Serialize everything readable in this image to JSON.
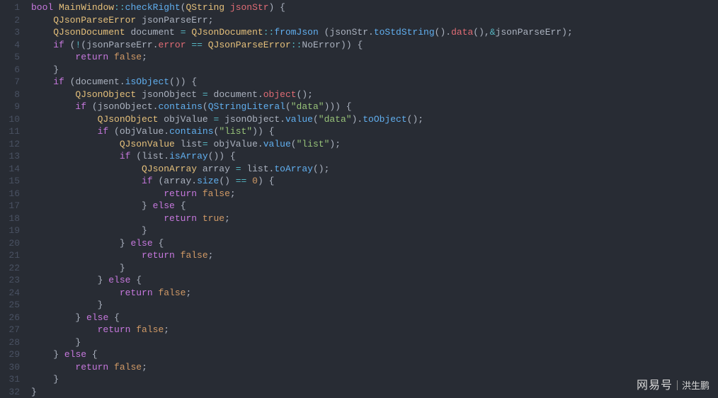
{
  "lines": [
    {
      "n": 1,
      "tokens": [
        [
          "kw",
          "bool"
        ],
        [
          "sp",
          " "
        ],
        [
          "class",
          "MainWindow"
        ],
        [
          "op",
          "::"
        ],
        [
          "fn",
          "checkRight"
        ],
        [
          "punc",
          "("
        ],
        [
          "class",
          "QString"
        ],
        [
          "sp",
          " "
        ],
        [
          "param",
          "jsonStr"
        ],
        [
          "punc",
          ")"
        ],
        [
          "sp",
          " "
        ],
        [
          "punc",
          "{"
        ]
      ]
    },
    {
      "n": 2,
      "tokens": [
        [
          "sp",
          "    "
        ],
        [
          "class",
          "QJsonParseError"
        ],
        [
          "sp",
          " "
        ],
        [
          "ident",
          "jsonParseErr"
        ],
        [
          "punc",
          ";"
        ]
      ]
    },
    {
      "n": 3,
      "tokens": [
        [
          "sp",
          "    "
        ],
        [
          "class",
          "QJsonDocument"
        ],
        [
          "sp",
          " "
        ],
        [
          "ident",
          "document"
        ],
        [
          "sp",
          " "
        ],
        [
          "op",
          "="
        ],
        [
          "sp",
          " "
        ],
        [
          "class",
          "QJsonDocument"
        ],
        [
          "op",
          "::"
        ],
        [
          "fn",
          "fromJson"
        ],
        [
          "sp",
          " "
        ],
        [
          "punc",
          "("
        ],
        [
          "ident",
          "jsonStr"
        ],
        [
          "punc",
          "."
        ],
        [
          "call",
          "toStdString"
        ],
        [
          "punc",
          "()"
        ],
        [
          "punc",
          "."
        ],
        [
          "err",
          "data"
        ],
        [
          "punc",
          "()"
        ],
        [
          "punc",
          ","
        ],
        [
          "op",
          "&"
        ],
        [
          "ident",
          "jsonParseErr"
        ],
        [
          "punc",
          ")"
        ],
        [
          "punc",
          ";"
        ]
      ]
    },
    {
      "n": 4,
      "tokens": [
        [
          "sp",
          "    "
        ],
        [
          "kw",
          "if"
        ],
        [
          "sp",
          " "
        ],
        [
          "punc",
          "("
        ],
        [
          "op",
          "!"
        ],
        [
          "punc",
          "("
        ],
        [
          "ident",
          "jsonParseErr"
        ],
        [
          "punc",
          "."
        ],
        [
          "prop",
          "error"
        ],
        [
          "sp",
          " "
        ],
        [
          "op",
          "=="
        ],
        [
          "sp",
          " "
        ],
        [
          "class",
          "QJsonParseError"
        ],
        [
          "op",
          "::"
        ],
        [
          "ident",
          "NoError"
        ],
        [
          "punc",
          "))"
        ],
        [
          "sp",
          " "
        ],
        [
          "punc",
          "{"
        ]
      ]
    },
    {
      "n": 5,
      "tokens": [
        [
          "sp",
          "        "
        ],
        [
          "kw",
          "return"
        ],
        [
          "sp",
          " "
        ],
        [
          "const",
          "false"
        ],
        [
          "punc",
          ";"
        ]
      ]
    },
    {
      "n": 6,
      "tokens": [
        [
          "sp",
          "    "
        ],
        [
          "punc",
          "}"
        ]
      ]
    },
    {
      "n": 7,
      "tokens": [
        [
          "sp",
          "    "
        ],
        [
          "kw",
          "if"
        ],
        [
          "sp",
          " "
        ],
        [
          "punc",
          "("
        ],
        [
          "ident",
          "document"
        ],
        [
          "punc",
          "."
        ],
        [
          "call",
          "isObject"
        ],
        [
          "punc",
          "())"
        ],
        [
          "sp",
          " "
        ],
        [
          "punc",
          "{"
        ]
      ]
    },
    {
      "n": 8,
      "tokens": [
        [
          "sp",
          "        "
        ],
        [
          "class",
          "QJsonObject"
        ],
        [
          "sp",
          " "
        ],
        [
          "ident",
          "jsonObject"
        ],
        [
          "sp",
          " "
        ],
        [
          "op",
          "="
        ],
        [
          "sp",
          " "
        ],
        [
          "ident",
          "document"
        ],
        [
          "punc",
          "."
        ],
        [
          "err",
          "object"
        ],
        [
          "punc",
          "()"
        ],
        [
          "punc",
          ";"
        ]
      ]
    },
    {
      "n": 9,
      "tokens": [
        [
          "sp",
          "        "
        ],
        [
          "kw",
          "if"
        ],
        [
          "sp",
          " "
        ],
        [
          "punc",
          "("
        ],
        [
          "ident",
          "jsonObject"
        ],
        [
          "punc",
          "."
        ],
        [
          "call",
          "contains"
        ],
        [
          "punc",
          "("
        ],
        [
          "call",
          "QStringLiteral"
        ],
        [
          "punc",
          "("
        ],
        [
          "str",
          "\"data\""
        ],
        [
          "punc",
          ")))"
        ],
        [
          "sp",
          " "
        ],
        [
          "punc",
          "{"
        ]
      ]
    },
    {
      "n": 10,
      "tokens": [
        [
          "sp",
          "            "
        ],
        [
          "class",
          "QJsonObject"
        ],
        [
          "sp",
          " "
        ],
        [
          "ident",
          "objValue"
        ],
        [
          "sp",
          " "
        ],
        [
          "op",
          "="
        ],
        [
          "sp",
          " "
        ],
        [
          "ident",
          "jsonObject"
        ],
        [
          "punc",
          "."
        ],
        [
          "call",
          "value"
        ],
        [
          "punc",
          "("
        ],
        [
          "str",
          "\"data\""
        ],
        [
          "punc",
          ")"
        ],
        [
          "punc",
          "."
        ],
        [
          "call",
          "toObject"
        ],
        [
          "punc",
          "()"
        ],
        [
          "punc",
          ";"
        ]
      ]
    },
    {
      "n": 11,
      "tokens": [
        [
          "sp",
          "            "
        ],
        [
          "kw",
          "if"
        ],
        [
          "sp",
          " "
        ],
        [
          "punc",
          "("
        ],
        [
          "ident",
          "objValue"
        ],
        [
          "punc",
          "."
        ],
        [
          "call",
          "contains"
        ],
        [
          "punc",
          "("
        ],
        [
          "str",
          "\"list\""
        ],
        [
          "punc",
          "))"
        ],
        [
          "sp",
          " "
        ],
        [
          "punc",
          "{"
        ]
      ]
    },
    {
      "n": 12,
      "tokens": [
        [
          "sp",
          "                "
        ],
        [
          "class",
          "QJsonValue"
        ],
        [
          "sp",
          " "
        ],
        [
          "ident",
          "list"
        ],
        [
          "op",
          "="
        ],
        [
          "sp",
          " "
        ],
        [
          "ident",
          "objValue"
        ],
        [
          "punc",
          "."
        ],
        [
          "call",
          "value"
        ],
        [
          "punc",
          "("
        ],
        [
          "str",
          "\"list\""
        ],
        [
          "punc",
          ")"
        ],
        [
          "punc",
          ";"
        ]
      ]
    },
    {
      "n": 13,
      "tokens": [
        [
          "sp",
          "                "
        ],
        [
          "kw",
          "if"
        ],
        [
          "sp",
          " "
        ],
        [
          "punc",
          "("
        ],
        [
          "ident",
          "list"
        ],
        [
          "punc",
          "."
        ],
        [
          "call",
          "isArray"
        ],
        [
          "punc",
          "())"
        ],
        [
          "sp",
          " "
        ],
        [
          "punc",
          "{"
        ]
      ]
    },
    {
      "n": 14,
      "tokens": [
        [
          "sp",
          "                    "
        ],
        [
          "class",
          "QJsonArray"
        ],
        [
          "sp",
          " "
        ],
        [
          "ident",
          "array"
        ],
        [
          "sp",
          " "
        ],
        [
          "op",
          "="
        ],
        [
          "sp",
          " "
        ],
        [
          "ident",
          "list"
        ],
        [
          "punc",
          "."
        ],
        [
          "call",
          "toArray"
        ],
        [
          "punc",
          "()"
        ],
        [
          "punc",
          ";"
        ]
      ]
    },
    {
      "n": 15,
      "tokens": [
        [
          "sp",
          "                    "
        ],
        [
          "kw",
          "if"
        ],
        [
          "sp",
          " "
        ],
        [
          "punc",
          "("
        ],
        [
          "ident",
          "array"
        ],
        [
          "punc",
          "."
        ],
        [
          "call",
          "size"
        ],
        [
          "punc",
          "()"
        ],
        [
          "sp",
          " "
        ],
        [
          "op",
          "=="
        ],
        [
          "sp",
          " "
        ],
        [
          "num",
          "0"
        ],
        [
          "punc",
          ")"
        ],
        [
          "sp",
          " "
        ],
        [
          "punc",
          "{"
        ]
      ]
    },
    {
      "n": 16,
      "tokens": [
        [
          "sp",
          "                        "
        ],
        [
          "kw",
          "return"
        ],
        [
          "sp",
          " "
        ],
        [
          "const",
          "false"
        ],
        [
          "punc",
          ";"
        ]
      ]
    },
    {
      "n": 17,
      "tokens": [
        [
          "sp",
          "                    "
        ],
        [
          "punc",
          "}"
        ],
        [
          "sp",
          " "
        ],
        [
          "kw",
          "else"
        ],
        [
          "sp",
          " "
        ],
        [
          "punc",
          "{"
        ]
      ]
    },
    {
      "n": 18,
      "tokens": [
        [
          "sp",
          "                        "
        ],
        [
          "kw",
          "return"
        ],
        [
          "sp",
          " "
        ],
        [
          "const",
          "true"
        ],
        [
          "punc",
          ";"
        ]
      ]
    },
    {
      "n": 19,
      "tokens": [
        [
          "sp",
          "                    "
        ],
        [
          "punc",
          "}"
        ]
      ]
    },
    {
      "n": 20,
      "tokens": [
        [
          "sp",
          "                "
        ],
        [
          "punc",
          "}"
        ],
        [
          "sp",
          " "
        ],
        [
          "kw",
          "else"
        ],
        [
          "sp",
          " "
        ],
        [
          "punc",
          "{"
        ]
      ]
    },
    {
      "n": 21,
      "tokens": [
        [
          "sp",
          "                    "
        ],
        [
          "kw",
          "return"
        ],
        [
          "sp",
          " "
        ],
        [
          "const",
          "false"
        ],
        [
          "punc",
          ";"
        ]
      ]
    },
    {
      "n": 22,
      "tokens": [
        [
          "sp",
          "                "
        ],
        [
          "punc",
          "}"
        ]
      ]
    },
    {
      "n": 23,
      "tokens": [
        [
          "sp",
          "            "
        ],
        [
          "punc",
          "}"
        ],
        [
          "sp",
          " "
        ],
        [
          "kw",
          "else"
        ],
        [
          "sp",
          " "
        ],
        [
          "punc",
          "{"
        ]
      ]
    },
    {
      "n": 24,
      "tokens": [
        [
          "sp",
          "                "
        ],
        [
          "kw",
          "return"
        ],
        [
          "sp",
          " "
        ],
        [
          "const",
          "false"
        ],
        [
          "punc",
          ";"
        ]
      ]
    },
    {
      "n": 25,
      "tokens": [
        [
          "sp",
          "            "
        ],
        [
          "punc",
          "}"
        ]
      ]
    },
    {
      "n": 26,
      "tokens": [
        [
          "sp",
          "        "
        ],
        [
          "punc",
          "}"
        ],
        [
          "sp",
          " "
        ],
        [
          "kw",
          "else"
        ],
        [
          "sp",
          " "
        ],
        [
          "punc",
          "{"
        ]
      ]
    },
    {
      "n": 27,
      "tokens": [
        [
          "sp",
          "            "
        ],
        [
          "kw",
          "return"
        ],
        [
          "sp",
          " "
        ],
        [
          "const",
          "false"
        ],
        [
          "punc",
          ";"
        ]
      ]
    },
    {
      "n": 28,
      "tokens": [
        [
          "sp",
          "        "
        ],
        [
          "punc",
          "}"
        ]
      ]
    },
    {
      "n": 29,
      "tokens": [
        [
          "sp",
          "    "
        ],
        [
          "punc",
          "}"
        ],
        [
          "sp",
          " "
        ],
        [
          "kw",
          "else"
        ],
        [
          "sp",
          " "
        ],
        [
          "punc",
          "{"
        ]
      ]
    },
    {
      "n": 30,
      "tokens": [
        [
          "sp",
          "        "
        ],
        [
          "kw",
          "return"
        ],
        [
          "sp",
          " "
        ],
        [
          "const",
          "false"
        ],
        [
          "punc",
          ";"
        ]
      ]
    },
    {
      "n": 31,
      "tokens": [
        [
          "sp",
          "    "
        ],
        [
          "punc",
          "}"
        ]
      ]
    },
    {
      "n": 32,
      "tokens": [
        [
          "punc",
          "}"
        ]
      ]
    }
  ],
  "watermark": {
    "logo": "网易号",
    "author": "洪生鹏"
  }
}
